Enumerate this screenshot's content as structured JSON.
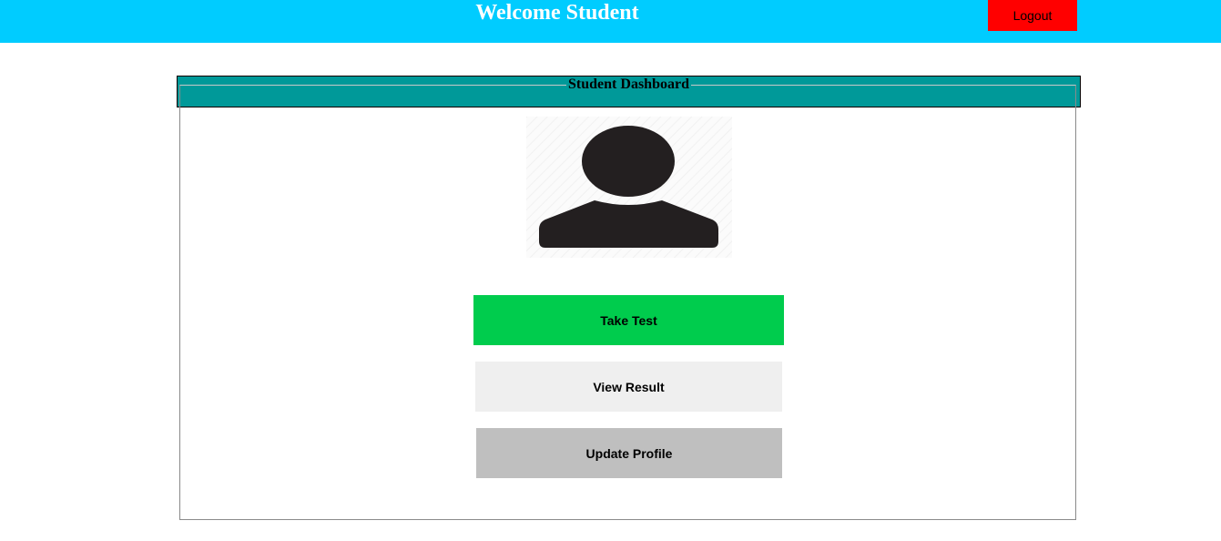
{
  "header": {
    "title": "Welcome Student",
    "logout_label": "Logout",
    "bg_color": "#00ccff",
    "logout_color": "#ff0000"
  },
  "dashboard": {
    "legend": "Student Dashboard",
    "band_color": "#009999",
    "avatar_icon": "user-avatar-icon"
  },
  "actions": {
    "take_test_label": "Take Test",
    "view_result_label": "View Result",
    "update_profile_label": "Update Profile",
    "take_test_color": "#00cc4d",
    "view_result_color": "#efefef",
    "update_profile_color": "#bfbfbf"
  }
}
